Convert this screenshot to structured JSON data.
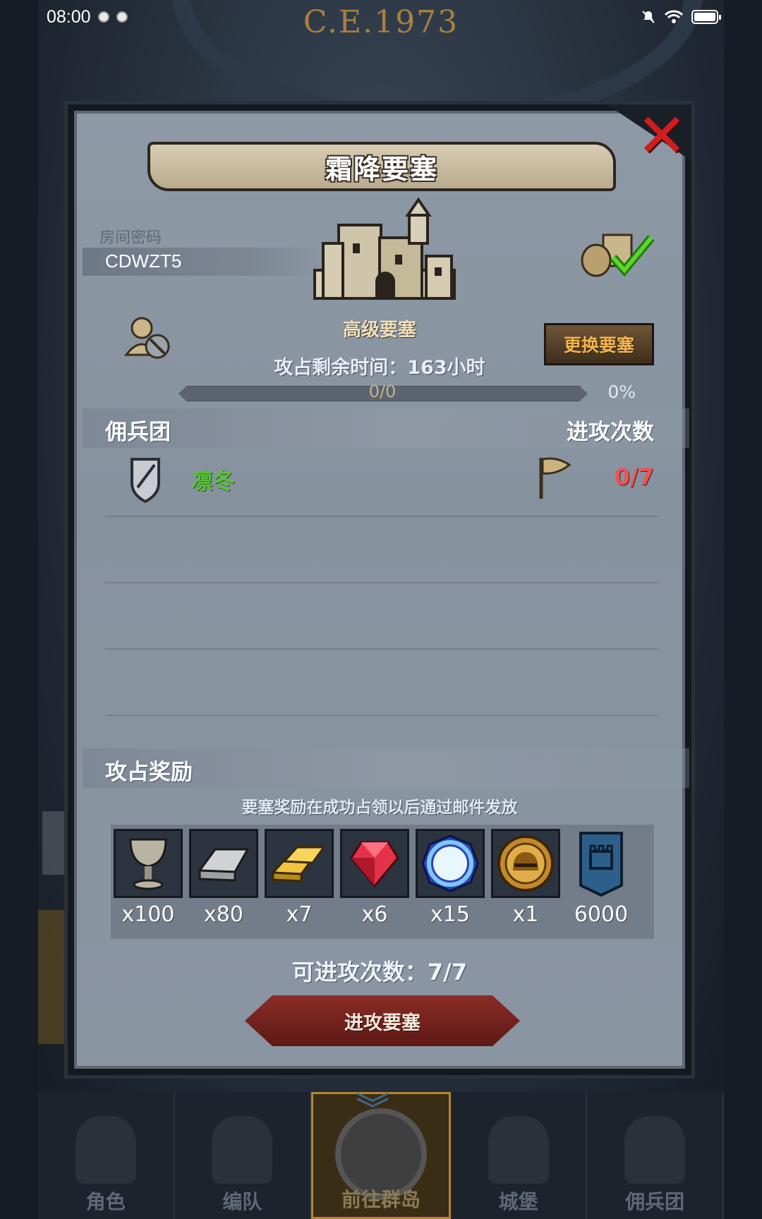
{
  "status_bar": {
    "time": "08:00"
  },
  "background": {
    "year": "C.E.1973"
  },
  "dialog": {
    "title": "霜降要塞",
    "room_password_label": "房间密码",
    "room_password": "CDWZT5",
    "fortress_grade": "高级要塞",
    "change_button": "更换要塞",
    "remaining_time": "攻占剩余时间：163小时",
    "progress": {
      "text": "0/0",
      "percent": "0%",
      "fraction": 0
    },
    "mercenary_header": "佣兵团",
    "attack_count_header": "进攻次数",
    "mercenary_rows": [
      {
        "name": "凛冬",
        "count": "0/7"
      }
    ],
    "reward_section": "攻占奖励",
    "reward_note": "要塞奖励在成功占领以后通过邮件发放",
    "rewards": [
      {
        "icon": "goblet-icon",
        "qty": "x100"
      },
      {
        "icon": "iron-bar-icon",
        "qty": "x80"
      },
      {
        "icon": "gold-bars-icon",
        "qty": "x7"
      },
      {
        "icon": "ruby-icon",
        "qty": "x6"
      },
      {
        "icon": "blue-crystal-icon",
        "qty": "x15"
      },
      {
        "icon": "knight-helmet-coin-icon",
        "qty": "x1"
      },
      {
        "icon": "fortress-banner-icon",
        "qty": "6000"
      }
    ],
    "attempts": "可进攻次数：7/7",
    "attack_button": "进攻要塞"
  },
  "bottom_nav": {
    "items": [
      {
        "label": "角色"
      },
      {
        "label": "编队"
      },
      {
        "label": "前往群岛",
        "active": true
      },
      {
        "label": "城堡"
      },
      {
        "label": "佣兵团"
      }
    ]
  },
  "colors": {
    "close": "#d11d1d",
    "merc_name": "#5ac23a",
    "attack_count": "#ee5252",
    "change_button_text": "#f4b44c"
  }
}
